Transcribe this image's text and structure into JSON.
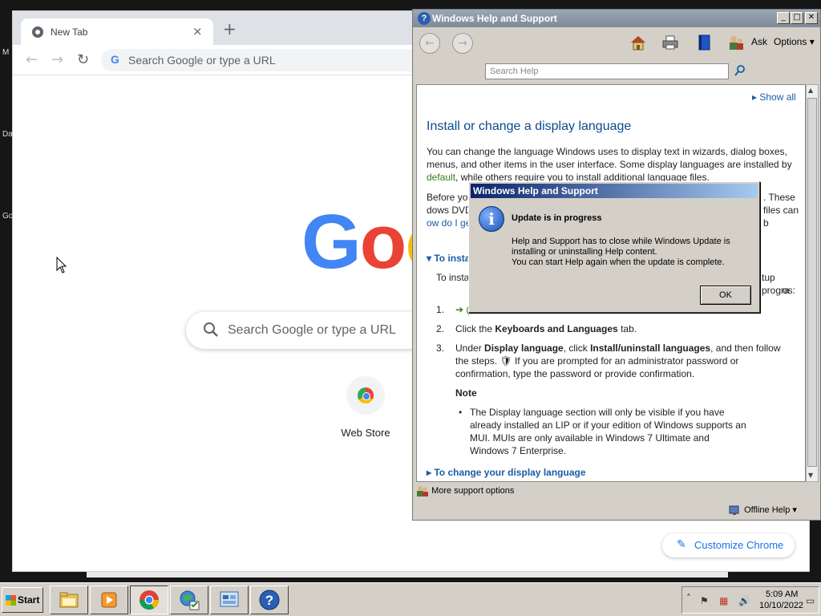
{
  "desktop": {
    "labels": [
      "M",
      "Da",
      "Go"
    ]
  },
  "chrome": {
    "tab_title": "New Tab",
    "tab_close": "×",
    "new_tab": "+",
    "back": "←",
    "forward": "→",
    "reload": "↻",
    "omnibox_g": "G",
    "omnibox_placeholder": "Search Google or type a URL",
    "logo": [
      "G",
      "o",
      "o"
    ],
    "search_placeholder": "Search Google or type a URL",
    "shortcut_label": "Web Store",
    "customize_label": "Customize Chrome"
  },
  "help": {
    "title": "Windows Help and Support",
    "title_icon": "?",
    "min": "_",
    "max": "□",
    "close": "✕",
    "back": "←",
    "forward": "→",
    "ask": "Ask",
    "options": "Options ▾",
    "search_placeholder": "Search Help",
    "show_all": "▸ Show all",
    "heading": "Install or change a display language",
    "para1_a": "You can change the language Windows uses to display text in wizards, dialog boxes, menus, and other items in the user interface. Some display languages are installed by ",
    "para1_link": "default",
    "para1_b": ", while others require you to install additional language files.",
    "para2_a": "Before yo",
    "para2_b": ". These files can b",
    "para2_c": "dows DVD. They",
    "para2_link": "ow do I get additi",
    "section1": "▾ To insta",
    "para3_a": "To insta",
    "para3_b": "tup progra",
    "para3_c": "os:",
    "step1_num": "1.",
    "step1_text": "➔ (",
    "step2_num": "2.",
    "step2_pre": "Click the ",
    "step2_bold": "Keyboards and Languages",
    "step2_post": " tab.",
    "step3_num": "3.",
    "step3_pre": "Under ",
    "step3_bold1": "Display language",
    "step3_mid": ", click ",
    "step3_bold2": "Install/uninstall languages",
    "step3_post": ", and then follow the steps. ",
    "step3_shield": "🛡",
    "step3_tail": " If you are prompted for an administrator password or confirmation, type the password or provide confirmation.",
    "note_label": "Note",
    "note_text": "The Display language section will only be visible if you have already installed an LIP or if your edition of Windows supports an MUI. MUIs are only available in Windows 7 Ultimate and Windows 7 Enterprise.",
    "section2": "▸ To change your display language",
    "more_support": "More support options",
    "offline_help": "Offline Help ▾"
  },
  "dialog": {
    "title": "Windows Help and Support",
    "icon": "i",
    "heading": "Update is in progress",
    "line1": "Help and Support has to close while Windows Update is",
    "line2": "installing or uninstalling Help content.",
    "line3": "You can start Help again when the update is complete.",
    "ok": "OK"
  },
  "taskbar": {
    "start": "Start",
    "buttons": [
      "explorer",
      "media-player",
      "chrome",
      "network",
      "control-panel",
      "help"
    ],
    "tray_chevron": "˄",
    "time": "5:09 AM",
    "date": "10/10/2022"
  },
  "colors": {
    "help_link": "#1a5da5",
    "help_heading": "#0b4b8c",
    "green_link": "#3a7a1a",
    "chrome_blue": "#1a73e8"
  }
}
